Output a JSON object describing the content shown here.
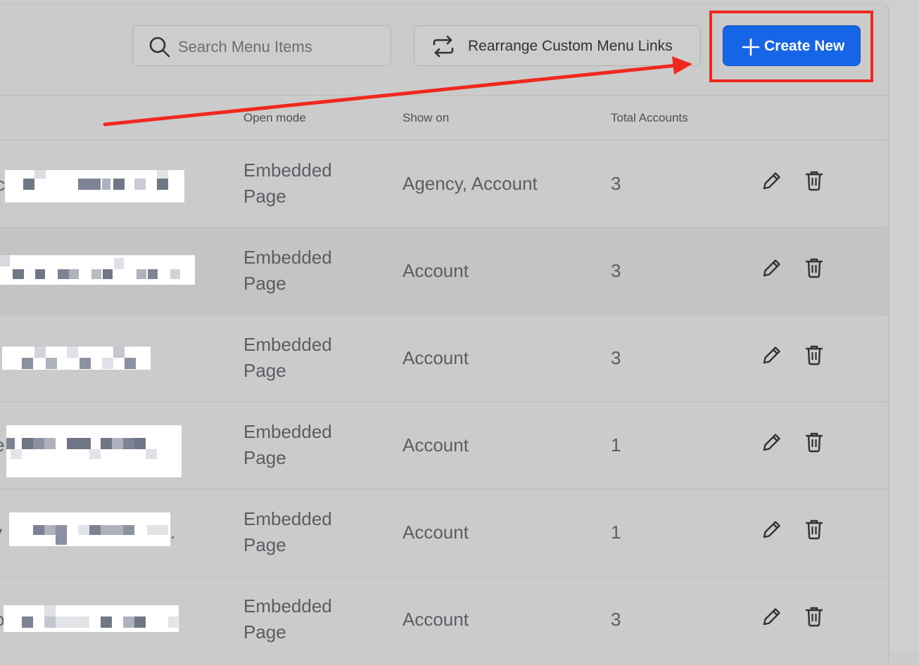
{
  "search": {
    "placeholder": "Search Menu Items",
    "icon": "search-icon"
  },
  "toolbar": {
    "rearrange_label": "Rearrange Custom Menu Links",
    "create_label": "Create New"
  },
  "colors": {
    "primary": "#1565e6",
    "annotation": "#f0281e"
  },
  "table": {
    "columns": [
      "Open mode",
      "Show on",
      "Total Accounts"
    ],
    "rows": [
      {
        "open_mode": [
          "Embedded",
          "Page"
        ],
        "show_on": "Agency, Account",
        "total": "3"
      },
      {
        "open_mode": [
          "Embedded",
          "Page"
        ],
        "show_on": "Account",
        "total": "3"
      },
      {
        "open_mode": [
          "Embedded",
          "Page"
        ],
        "show_on": "Account",
        "total": "3"
      },
      {
        "open_mode": [
          "Embedded",
          "Page"
        ],
        "show_on": "Account",
        "total": "1"
      },
      {
        "open_mode": [
          "Embedded",
          "Page"
        ],
        "show_on": "Account",
        "total": "1"
      },
      {
        "open_mode": [
          "Embedded",
          "Page"
        ],
        "show_on": "Account",
        "total": "3"
      }
    ]
  }
}
